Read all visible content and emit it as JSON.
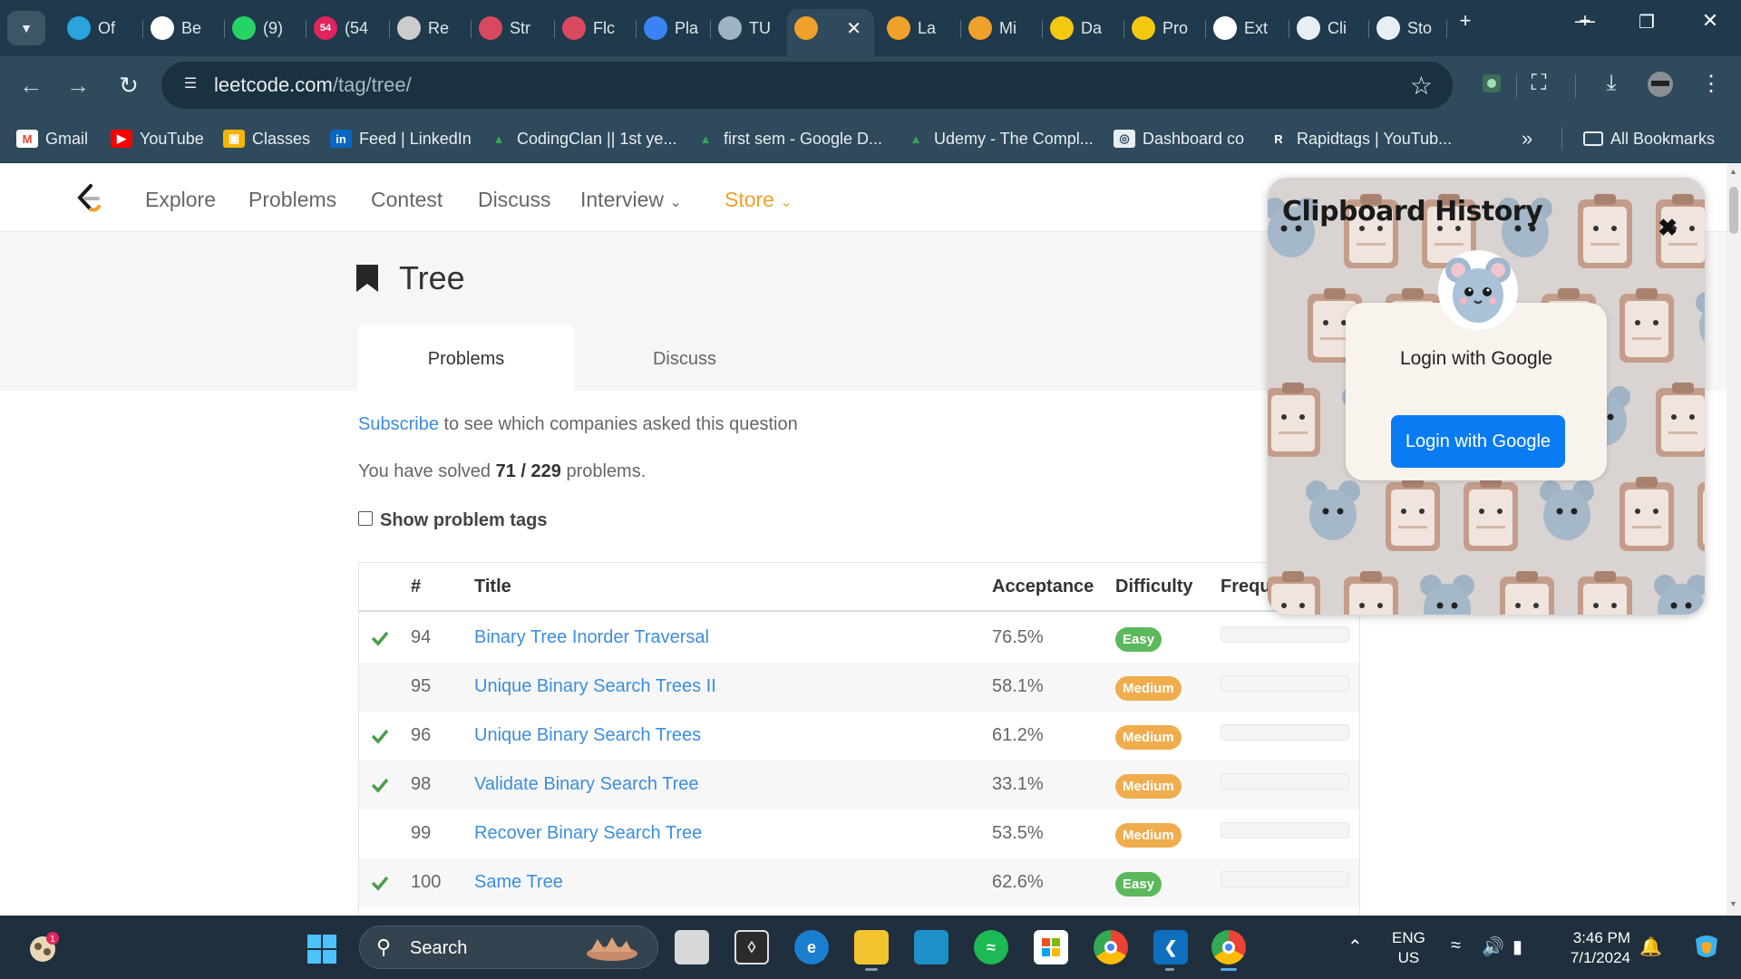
{
  "browser": {
    "tabs": [
      {
        "label": "Of",
        "icon": "telegram-icon",
        "color": "#2aa3df"
      },
      {
        "label": "Be",
        "icon": "chatgpt-icon",
        "color": "#ffffff"
      },
      {
        "label": "(9)",
        "icon": "whatsapp-icon",
        "color": "#25d366"
      },
      {
        "label": "(54",
        "icon": "app-badge-icon",
        "color": "#e0245e",
        "badge": "54"
      },
      {
        "label": "Re",
        "icon": "record-icon",
        "color": "#cccccc"
      },
      {
        "label": "Str",
        "icon": "site-icon",
        "color": "#d9485f"
      },
      {
        "label": "Flc",
        "icon": "site-icon",
        "color": "#d9485f"
      },
      {
        "label": "Pla",
        "icon": "planner-icon",
        "color": "#3b82f6"
      },
      {
        "label": "TU",
        "icon": "site-icon",
        "color": "#9fb3c2"
      },
      {
        "label": "",
        "icon": "leetcode-icon",
        "color": "#f0a12b",
        "active": true
      },
      {
        "label": "La",
        "icon": "leetcode-icon",
        "color": "#f0a12b"
      },
      {
        "label": "Mi",
        "icon": "leetcode-icon",
        "color": "#f0a12b"
      },
      {
        "label": "Da",
        "icon": "chart-icon",
        "color": "#f2c811"
      },
      {
        "label": "Pro",
        "icon": "chart-icon",
        "color": "#f2c811"
      },
      {
        "label": "Ext",
        "icon": "puzzle-icon",
        "color": "#ffffff"
      },
      {
        "label": "Cli",
        "icon": "clipboard-icon",
        "color": "#e8eef2"
      },
      {
        "label": "Sto",
        "icon": "clipboard-icon",
        "color": "#e8eef2"
      }
    ],
    "url_host": "leetcode.com",
    "url_path": "/tag/tree/",
    "bookmarks": [
      {
        "label": "Gmail",
        "icon": "gmail-icon"
      },
      {
        "label": "YouTube",
        "icon": "youtube-icon"
      },
      {
        "label": "Classes",
        "icon": "classroom-icon"
      },
      {
        "label": "Feed | LinkedIn",
        "icon": "linkedin-icon"
      },
      {
        "label": "CodingClan || 1st ye...",
        "icon": "drive-icon"
      },
      {
        "label": "first sem - Google D...",
        "icon": "drive-icon"
      },
      {
        "label": "Udemy - The Compl...",
        "icon": "drive-icon"
      },
      {
        "label": "Dashboard co",
        "icon": "globe-icon"
      },
      {
        "label": "Rapidtags | YouTub...",
        "icon": "rapidtags-icon"
      }
    ],
    "all_bookmarks": "All Bookmarks"
  },
  "nav": {
    "items": [
      "Explore",
      "Problems",
      "Contest",
      "Discuss",
      "Interview",
      "Store"
    ]
  },
  "tag": {
    "title": "Tree",
    "tabs": [
      "Problems",
      "Discuss"
    ],
    "subscribe_link": "Subscribe",
    "subscribe_rest": " to see which companies asked this question",
    "solved_prefix": "You have solved ",
    "solved_count": "71 / 229",
    "solved_suffix": " problems.",
    "show_tags": "Show problem tags"
  },
  "table": {
    "headers": [
      "#",
      "Title",
      "Acceptance",
      "Difficulty",
      "Frequ"
    ],
    "rows": [
      {
        "solved": true,
        "num": "94",
        "title": "Binary Tree Inorder Traversal",
        "acceptance": "76.5%",
        "difficulty": "Easy"
      },
      {
        "solved": false,
        "num": "95",
        "title": "Unique Binary Search Trees II",
        "acceptance": "58.1%",
        "difficulty": "Medium"
      },
      {
        "solved": true,
        "num": "96",
        "title": "Unique Binary Search Trees",
        "acceptance": "61.2%",
        "difficulty": "Medium"
      },
      {
        "solved": true,
        "num": "98",
        "title": "Validate Binary Search Tree",
        "acceptance": "33.1%",
        "difficulty": "Medium"
      },
      {
        "solved": false,
        "num": "99",
        "title": "Recover Binary Search Tree",
        "acceptance": "53.5%",
        "difficulty": "Medium"
      },
      {
        "solved": true,
        "num": "100",
        "title": "Same Tree",
        "acceptance": "62.6%",
        "difficulty": "Easy"
      }
    ]
  },
  "clipboard": {
    "title": "Clipboard History",
    "login_text": "Login with Google",
    "login_button": "Login with Google"
  },
  "taskbar": {
    "search": "Search",
    "notification_badge": "1",
    "lang_top": "ENG",
    "lang_bottom": "US",
    "time": "3:46 PM",
    "date": "7/1/2024"
  },
  "colors": {
    "accent_link": "#3c8dde",
    "store": "#f0a12b",
    "easy": "#5cb85c",
    "medium": "#f0ad4e",
    "login_button": "#0a7cf3"
  }
}
